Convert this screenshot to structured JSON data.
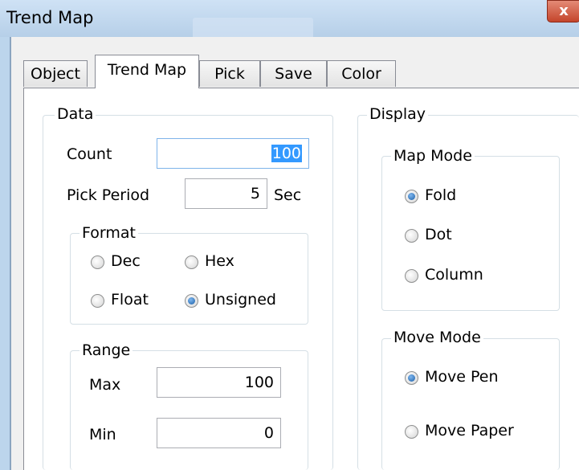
{
  "window": {
    "title": "Trend Map",
    "close_glyph": "x"
  },
  "tabs": [
    "Object",
    "Trend Map",
    "Pick",
    "Save",
    "Color"
  ],
  "active_tab": "Trend Map",
  "data_group": {
    "label": "Data",
    "count_label": "Count",
    "count_value": "100",
    "pick_period_label": "Pick Period",
    "pick_period_value": "5",
    "pick_period_unit": "Sec",
    "format": {
      "label": "Format",
      "options": [
        "Dec",
        "Hex",
        "Float",
        "Unsigned"
      ],
      "selected": "Unsigned"
    },
    "range": {
      "label": "Range",
      "max_label": "Max",
      "max_value": "100",
      "min_label": "Min",
      "min_value": "0"
    }
  },
  "display_group": {
    "label": "Display",
    "map_mode": {
      "label": "Map Mode",
      "options": [
        "Fold",
        "Dot",
        "Column"
      ],
      "selected": "Fold"
    },
    "move_mode": {
      "label": "Move Mode",
      "options": [
        "Move Pen",
        "Move Paper"
      ],
      "selected": "Move Pen"
    }
  }
}
